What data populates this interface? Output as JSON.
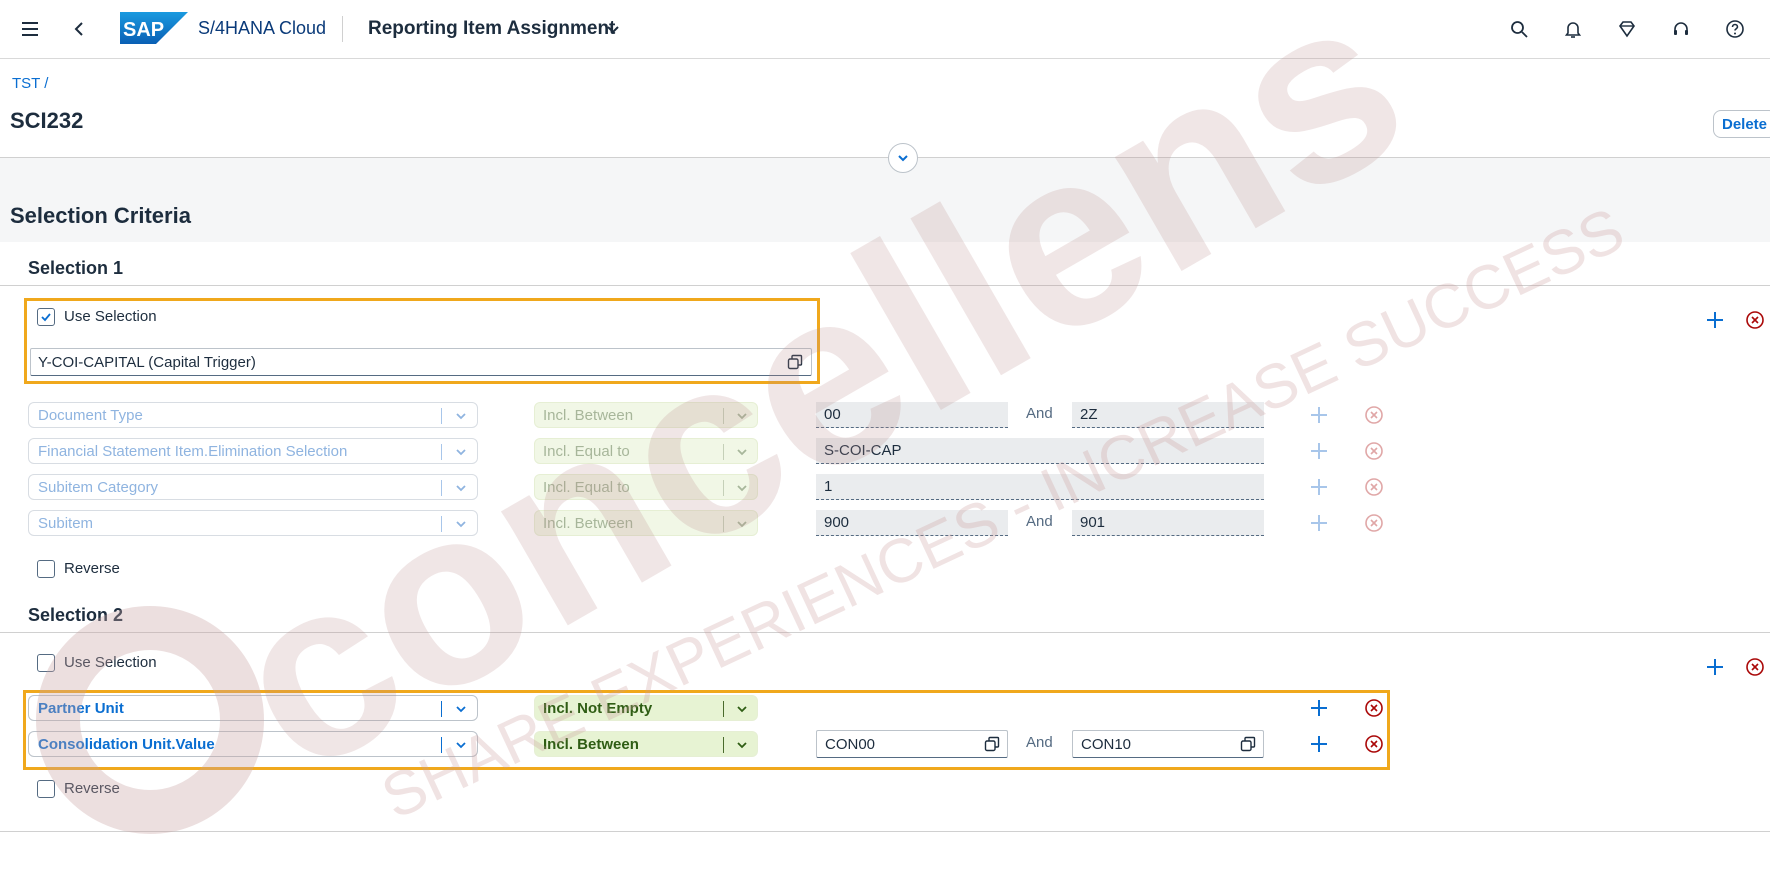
{
  "shell": {
    "product_name": "S/4HANA Cloud",
    "app_title": "Reporting Item Assignment",
    "logo_text": "SAP"
  },
  "header": {
    "breadcrumb": "TST /",
    "object_title": "SCI232",
    "delete_label": "Delete"
  },
  "section_title": "Selection Criteria",
  "selection1": {
    "title": "Selection 1",
    "use_selection_label": "Use Selection",
    "use_selection_checked": true,
    "trigger_value": "Y-COI-CAPITAL (Capital Trigger)",
    "rows": [
      {
        "field": "Document Type",
        "operator": "Incl. Between",
        "low": "00",
        "and": "And",
        "high": "2Z"
      },
      {
        "field": "Financial Statement Item.Elimination Selection",
        "operator": "Incl. Equal to",
        "low": "S-COI-CAP"
      },
      {
        "field": "Subitem Category",
        "operator": "Incl. Equal to",
        "low": "1"
      },
      {
        "field": "Subitem",
        "operator": "Incl. Between",
        "low": "900",
        "and": "And",
        "high": "901"
      }
    ],
    "reverse_label": "Reverse"
  },
  "selection2": {
    "title": "Selection 2",
    "use_selection_label": "Use Selection",
    "use_selection_checked": false,
    "rows": [
      {
        "field": "Partner Unit",
        "operator": "Incl. Not Empty"
      },
      {
        "field": "Consolidation Unit.Value",
        "operator": "Incl. Between",
        "low": "CON00",
        "and": "And",
        "high": "CON10"
      }
    ],
    "reverse_label": "Reverse"
  },
  "watermark": {
    "brand": "concellens",
    "tagline": "SHARE EXPERIENCES - INCREASE SUCCESS"
  },
  "colors": {
    "accent": "#0a6ed1",
    "highlight": "#f0a81c",
    "negative": "#aa0808",
    "watermark": "#c8a0a0"
  },
  "icons": [
    "menu-icon",
    "back-icon",
    "search-icon",
    "bell-icon",
    "diamond-icon",
    "headset-icon",
    "help-icon",
    "chevron-down-icon",
    "value-help-icon",
    "add-icon",
    "remove-icon",
    "checkmark-icon"
  ]
}
